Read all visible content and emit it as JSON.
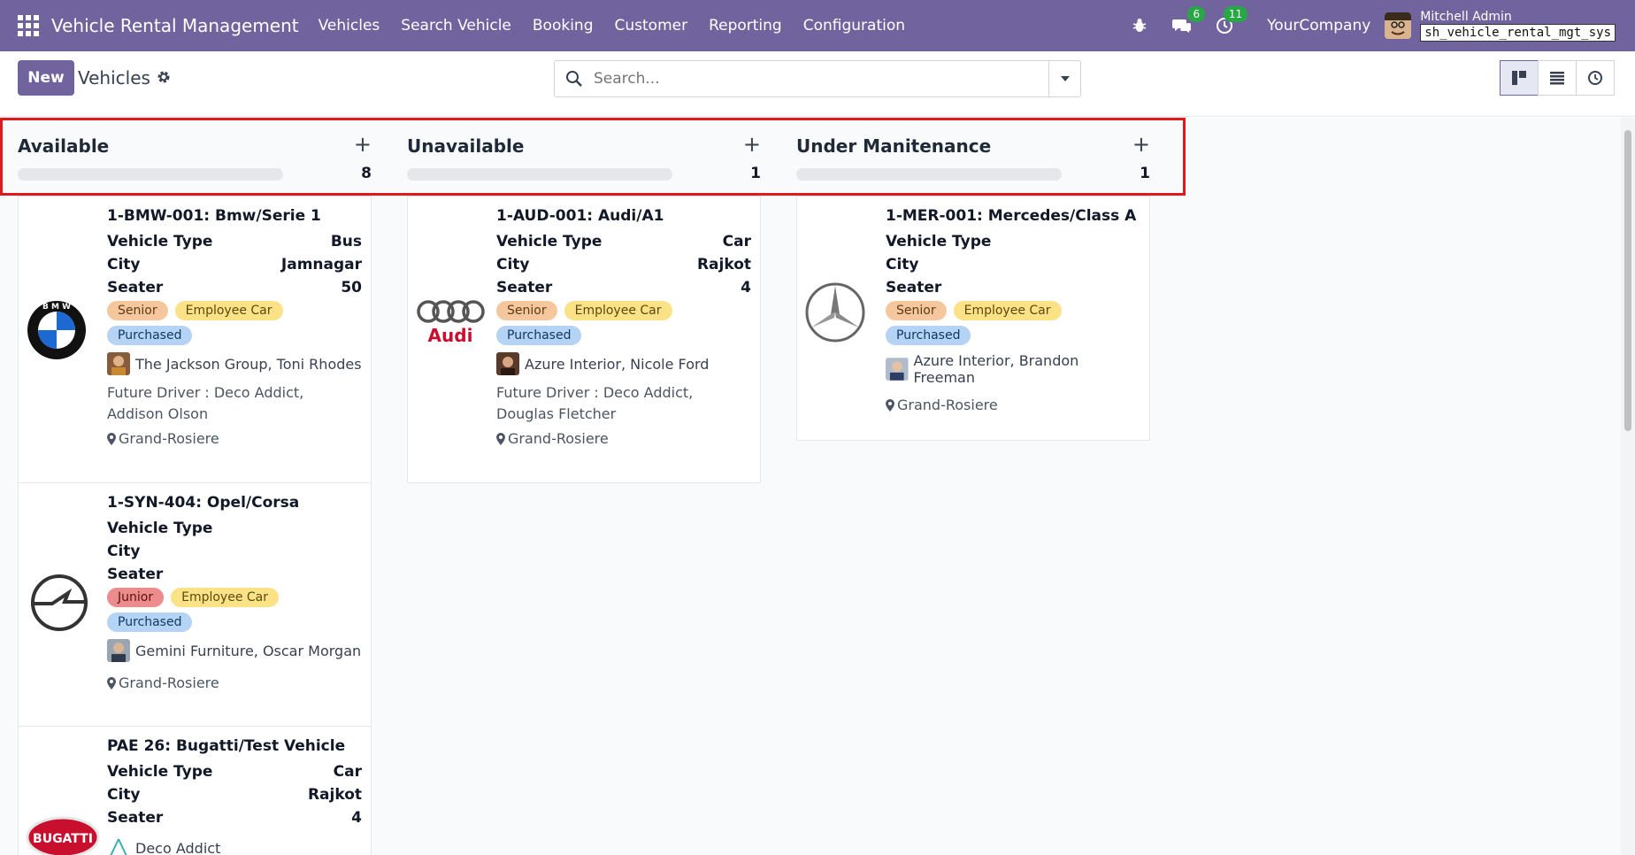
{
  "navbar": {
    "app_title": "Vehicle Rental Management",
    "menu": [
      "Vehicles",
      "Search Vehicle",
      "Booking",
      "Customer",
      "Reporting",
      "Configuration"
    ],
    "messages_badge": "6",
    "activities_badge": "11",
    "company": "YourCompany",
    "user_name": "Mitchell Admin",
    "db_name": "sh_vehicle_rental_mgt_sys"
  },
  "control": {
    "new_label": "New",
    "title": "Vehicles",
    "search_placeholder": "Search..."
  },
  "columns": [
    {
      "title": "Available",
      "count": "8",
      "cards": [
        {
          "title": "1-BMW-001: Bmw/Serie 1",
          "logo": "bmw-logo",
          "fields": [
            [
              "Vehicle Type",
              "Bus"
            ],
            [
              "City",
              "Jamnagar"
            ],
            [
              "Seater",
              "50"
            ]
          ],
          "tags": [
            "Senior",
            "Employee Car",
            "Purchased"
          ],
          "partner": "The Jackson Group, Toni Rhodes",
          "future": "Future Driver : Deco Addict, Addison Olson",
          "location": "Grand-Rosiere"
        },
        {
          "title": "1-SYN-404: Opel/Corsa",
          "logo": "opel-logo",
          "fields": [
            [
              "Vehicle Type",
              ""
            ],
            [
              "City",
              ""
            ],
            [
              "Seater",
              ""
            ]
          ],
          "tags": [
            "Junior",
            "Employee Car",
            "Purchased"
          ],
          "partner": "Gemini Furniture, Oscar Morgan",
          "location": "Grand-Rosiere"
        },
        {
          "title": "PAE 26: Bugatti/Test Vehicle",
          "logo": "bugatti-logo",
          "fields": [
            [
              "Vehicle Type",
              "Car"
            ],
            [
              "City",
              "Rajkot"
            ],
            [
              "Seater",
              "4"
            ]
          ],
          "partner": "Deco Addict"
        }
      ]
    },
    {
      "title": "Unavailable",
      "count": "1",
      "cards": [
        {
          "title": "1-AUD-001: Audi/A1",
          "logo": "audi-logo",
          "fields": [
            [
              "Vehicle Type",
              "Car"
            ],
            [
              "City",
              "Rajkot"
            ],
            [
              "Seater",
              "4"
            ]
          ],
          "tags": [
            "Senior",
            "Employee Car",
            "Purchased"
          ],
          "partner": "Azure Interior, Nicole Ford",
          "future": "Future Driver : Deco Addict, Douglas Fletcher",
          "location": "Grand-Rosiere"
        }
      ]
    },
    {
      "title": "Under Manitenance",
      "count": "1",
      "cards": [
        {
          "title": "1-MER-001: Mercedes/Class A",
          "logo": "mercedes-logo",
          "fields": [
            [
              "Vehicle Type",
              ""
            ],
            [
              "City",
              ""
            ],
            [
              "Seater",
              ""
            ]
          ],
          "tags": [
            "Senior",
            "Employee Car",
            "Purchased"
          ],
          "partner": "Azure Interior, Brandon Freeman",
          "location": "Grand-Rosiere"
        }
      ]
    }
  ],
  "audi_wordmark": "Audi",
  "bugatti_wordmark": "BUGATTI",
  "colors": {
    "brand": "#71639e",
    "highlight": "#e01a1a"
  }
}
